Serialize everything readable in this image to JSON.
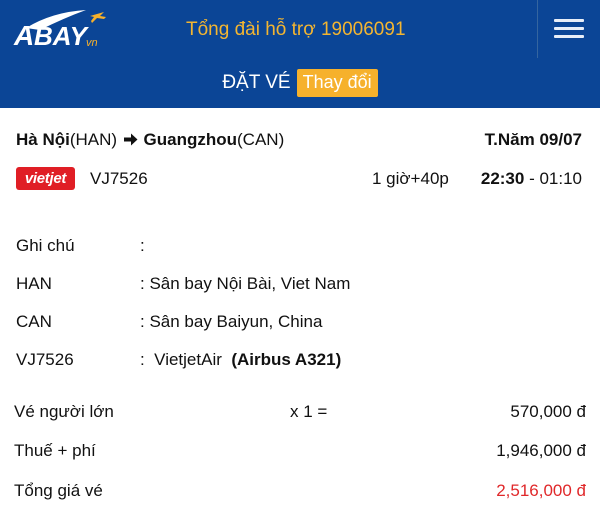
{
  "header": {
    "brand": "BAY",
    "brand_suffix": "vn",
    "hotline": "Tổng đài hỗ trợ 19006091"
  },
  "subbar": {
    "title": "ĐẶT VÉ",
    "change_label": "Thay đổi"
  },
  "route": {
    "origin_city": "Hà Nội",
    "origin_code": "(HAN)",
    "dest_city": "Guangzhou",
    "dest_code": "(CAN)",
    "date": "T.Năm 09/07"
  },
  "flight": {
    "airline_logo_text": "vietjet",
    "number": "VJ7526",
    "duration": "1 giờ+40p",
    "depart": "22:30",
    "separator": " - ",
    "arrive": "01:10"
  },
  "details": {
    "note_label": "Ghi chú",
    "note_value": ":",
    "origin_key": "HAN",
    "origin_value": ": Sân bay Nội Bài, Viet Nam",
    "dest_key": "CAN",
    "dest_value": ": Sân bay Baiyun, China",
    "flight_key": "VJ7526",
    "flight_prefix": ":  VietjetAir  ",
    "aircraft": "(Airbus A321)"
  },
  "pricing": {
    "adult_label": "Vé người lớn",
    "adult_qty": "x 1 =",
    "adult_price": "570,000 đ",
    "tax_label": "Thuế + phí",
    "tax_price": "1,946,000 đ",
    "total_label": "Tổng giá vé",
    "total_price": "2,516,000 đ"
  },
  "colors": {
    "header_bg": "#0b4596",
    "accent": "#f6b12c",
    "total_red": "#e0282a",
    "airline_red": "#e01e25"
  }
}
